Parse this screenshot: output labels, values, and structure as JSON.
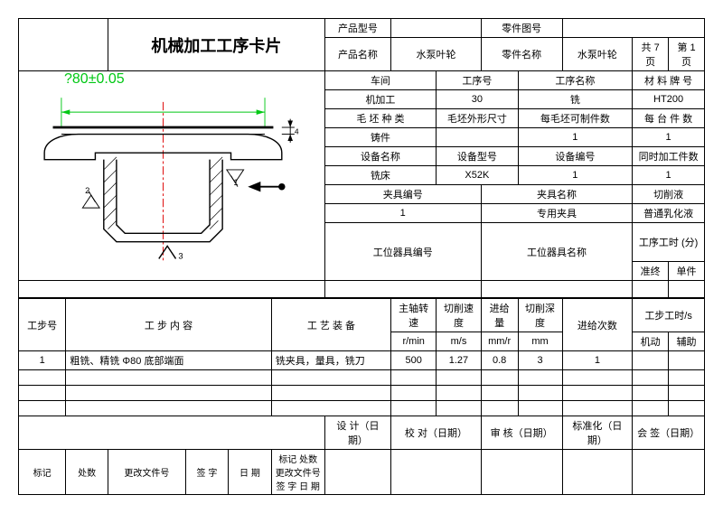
{
  "title": "机械加工工序卡片",
  "header": {
    "product_model_label": "产品型号",
    "part_drawing_no_label": "零件图号",
    "product_name_label": "产品名称",
    "product_name": "水泵叶轮",
    "part_name_label": "零件名称",
    "part_name": "水泵叶轮",
    "total_pages_prefix": "共",
    "total_pages": "7",
    "total_pages_suffix": "页",
    "page_prefix": "第",
    "page_no": "1",
    "page_suffix": "页"
  },
  "info": {
    "workshop_label": "车间",
    "process_no_label": "工序号",
    "process_name_label": "工序名称",
    "material_label": "材 料 牌 号",
    "workshop": "机加工",
    "process_no": "30",
    "process_name": "铣",
    "material": "HT200",
    "blank_kind_label": "毛 坯 种 类",
    "blank_dim_label": "毛坯外形尺寸",
    "parts_per_blank_label": "每毛坯可制件数",
    "parts_per_set_label": "每 台 件 数",
    "blank_kind": "铸件",
    "parts_per_blank": "1",
    "parts_per_set": "1",
    "equip_name_label": "设备名称",
    "equip_model_label": "设备型号",
    "equip_no_label": "设备编号",
    "simul_parts_label": "同时加工件数",
    "equip_name": "铣床",
    "equip_model": "X52K",
    "equip_no": "1",
    "simul_parts": "1",
    "fixture_no_label": "夹具编号",
    "fixture_name_label": "夹具名称",
    "coolant_label": "切削液",
    "fixture_no": "1",
    "fixture_name": "专用夹具",
    "coolant": "普通乳化液",
    "tool_no_label": "工位器具编号",
    "tool_name_label": "工位器具名称",
    "process_time_label": "工序工时 (分)",
    "final_label": "准终",
    "unit_label": "单件"
  },
  "dim": "?80±0.05",
  "step_headers": {
    "step_no": "工步号",
    "step_content": "工    步    内    容",
    "tooling": "工  艺  装  备",
    "spindle_speed": "主轴转速",
    "spindle_unit": "r/min",
    "cut_speed": "切削速度",
    "cut_speed_unit": "m/s",
    "feed": "进给量",
    "feed_unit": "mm/r",
    "cut_depth": "切削深度",
    "cut_depth_unit": "mm",
    "feed_count": "进给次数",
    "step_time": "工步工时/s",
    "machine": "机动",
    "aux": "辅助"
  },
  "steps": [
    {
      "no": "1",
      "content": "粗铣、精铣 Φ80 底部端面",
      "tooling": "铣夹具，量具，铣刀",
      "spindle": "500",
      "cut_speed": "1.27",
      "feed": "0.8",
      "depth": "3",
      "count": "1"
    }
  ],
  "footer": {
    "design": "设 计（日 期）",
    "check": "校 对（日期）",
    "audit": "审 核（日期）",
    "standard": "标准化（日期）",
    "sign": "会 签（日期）",
    "mark": "标记",
    "qty": "处数",
    "change_doc": "更改文件号",
    "signed": "签  字",
    "date": "日  期"
  }
}
